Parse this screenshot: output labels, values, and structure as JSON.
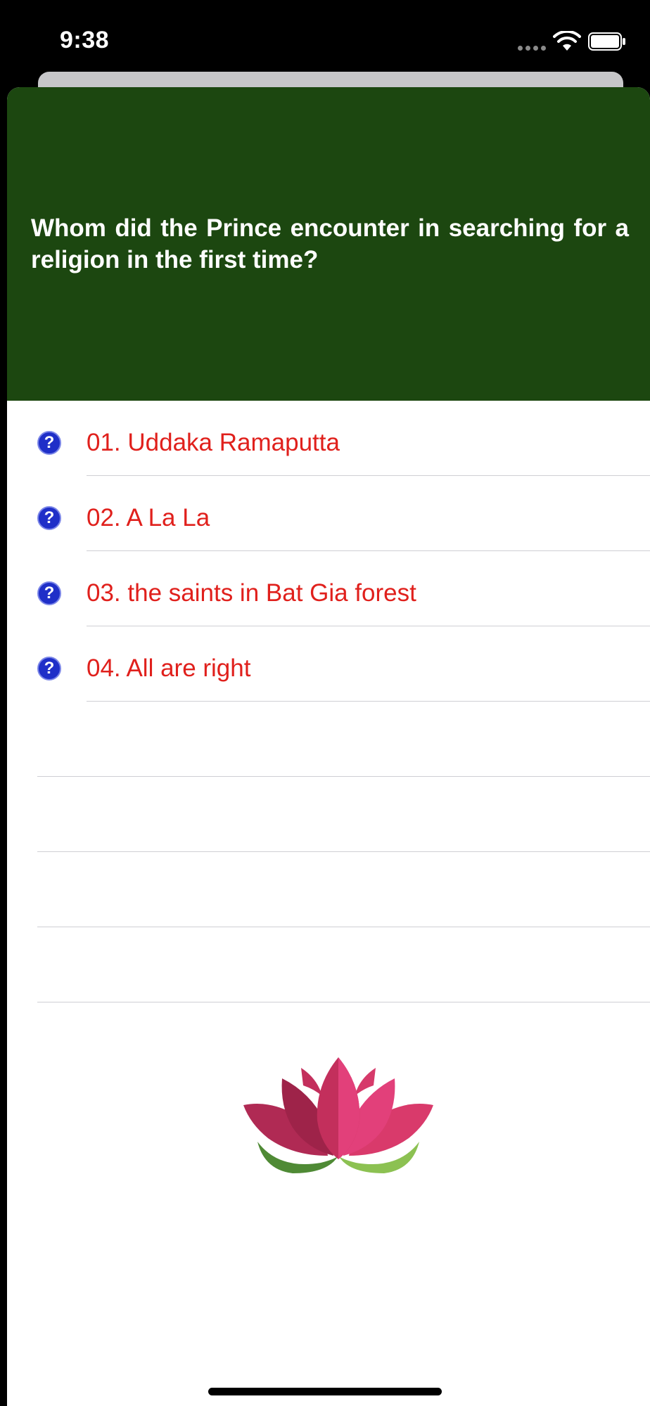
{
  "status_bar": {
    "time": "9:38",
    "icons": [
      "signal-icon",
      "wifi-icon",
      "battery-icon"
    ]
  },
  "question": {
    "text": "Whom did the Prince encounter in searching for a religion in the first time?"
  },
  "answers": [
    {
      "label": "01. Uddaka Ramaputta",
      "icon": "help-circle-icon"
    },
    {
      "label": "02. A La La",
      "icon": "help-circle-icon"
    },
    {
      "label": "03. the saints in Bat Gia forest",
      "icon": "help-circle-icon"
    },
    {
      "label": "04. All are right",
      "icon": "help-circle-icon"
    }
  ],
  "logo": {
    "icon": "lotus-logo"
  },
  "colors": {
    "header_bg": "#1c4710",
    "answer_text": "#e0201c",
    "icon_blue": "#1f2fc8",
    "lotus_pink": "#d63a6a",
    "lotus_green": "#5aa13a"
  }
}
